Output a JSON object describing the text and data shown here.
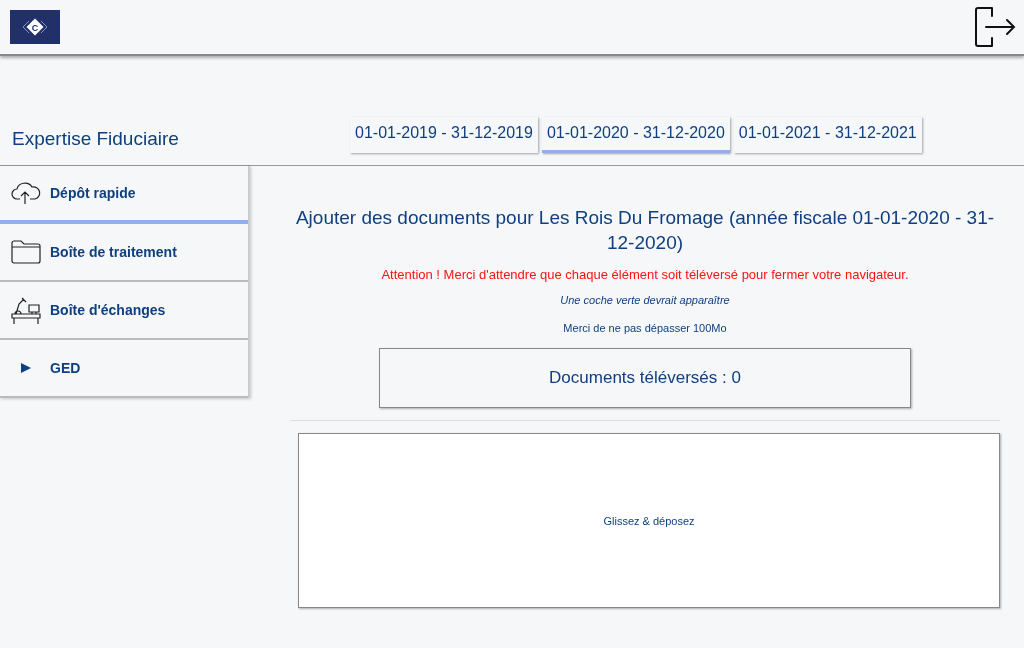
{
  "header": {
    "logo_letter": "C"
  },
  "company": "Expertise Fiduciaire",
  "tabs": [
    {
      "label": "01-01-2019 - 31-12-2019",
      "selected": false
    },
    {
      "label": "01-01-2020 - 31-12-2020",
      "selected": true
    },
    {
      "label": "01-01-2021 - 31-12-2021",
      "selected": false
    }
  ],
  "sidebar": {
    "items": [
      {
        "label": "Dépôt rapide",
        "kind": "upload",
        "selected": true
      },
      {
        "label": "Boîte de traitement",
        "kind": "folder",
        "selected": false
      },
      {
        "label": "Boîte d'échanges",
        "kind": "desk",
        "selected": false
      },
      {
        "label": "GED",
        "kind": "expand",
        "selected": false
      }
    ]
  },
  "main": {
    "heading": "Ajouter des documents pour Les Rois Du Fromage (année fiscale 01-01-2020 - 31-12-2020)",
    "warning": "Attention ! Merci d'attendre que chaque élément soit téléversé pour fermer votre navigateur.",
    "hint": "Une coche verte devrait apparaître",
    "limit": "Merci de ne pas dépasser 100Mo",
    "counter": "Documents téléversés : 0",
    "dropzone": "Glissez & déposez"
  }
}
